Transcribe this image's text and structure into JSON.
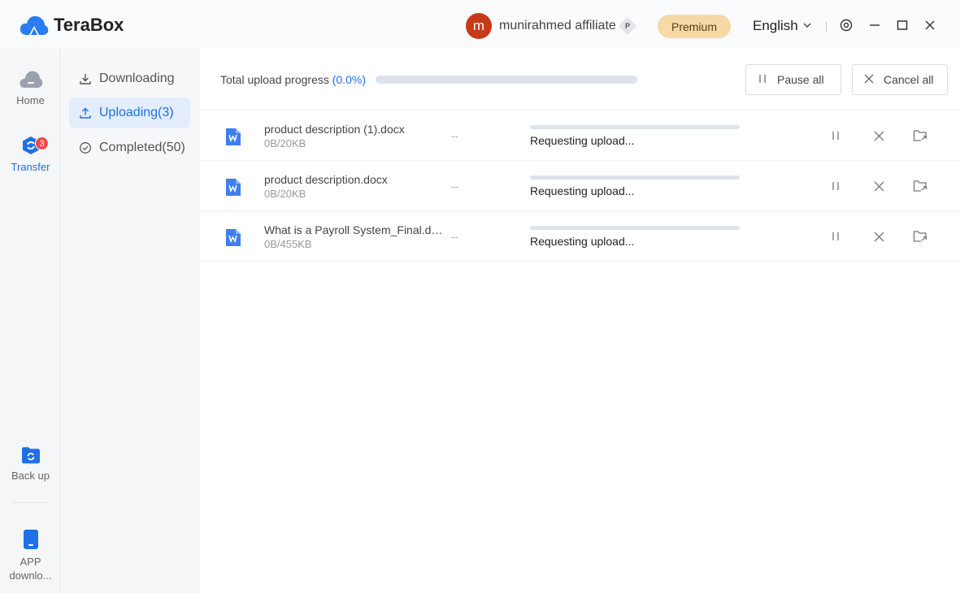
{
  "app": {
    "name": "TeraBox"
  },
  "header": {
    "avatar_letter": "m",
    "username": "munirahmed affiliate",
    "member_badge": "P",
    "premium_label": "Premium",
    "language": "English"
  },
  "leftnav": {
    "home": "Home",
    "transfer": "Transfer",
    "transfer_badge": "3",
    "backup": "Back up",
    "app_download": "APP downlo..."
  },
  "subnav": {
    "downloading": "Downloading",
    "uploading": "Uploading(3)",
    "completed": "Completed(50)"
  },
  "progress": {
    "label": "Total upload progress",
    "percent": "(0.0%)",
    "value": 0.0,
    "pause_all": "Pause all",
    "cancel_all": "Cancel all"
  },
  "uploads": [
    {
      "name": "product description (1).docx",
      "size": "0B/20KB",
      "speed": "--",
      "status": "Requesting upload..."
    },
    {
      "name": "product description.docx",
      "size": "0B/20KB",
      "speed": "--",
      "status": "Requesting upload..."
    },
    {
      "name": "What is a Payroll System_Final.do...",
      "size": "0B/455KB",
      "speed": "--",
      "status": "Requesting upload..."
    }
  ],
  "colors": {
    "accent": "#1f6fe6",
    "premium_bg": "#f6d9a7",
    "badge": "#f04848",
    "avatar": "#c63a18",
    "word_icon": "#3f7ef0"
  }
}
